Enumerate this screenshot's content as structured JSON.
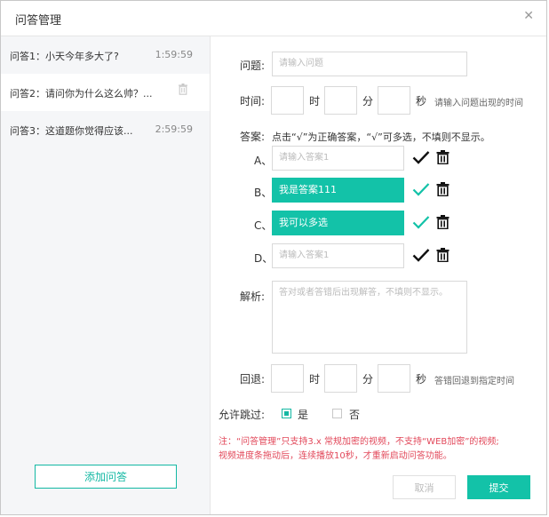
{
  "dialog": {
    "title": "问答管理"
  },
  "sidebar": {
    "items": [
      {
        "text": "问答1：小天今年多大了?",
        "time": "1:59:59"
      },
      {
        "text": "问答2：请问你为什么这么帅？...",
        "time": ""
      },
      {
        "text": "问答3：这道题你觉得应该...",
        "time": "2:59:59"
      }
    ],
    "add_label": "添加问答"
  },
  "form": {
    "question": {
      "label": "问题:",
      "placeholder": "请输入问题"
    },
    "time": {
      "label": "时间:",
      "hour": "时",
      "minute": "分",
      "second": "秒",
      "hint": "请输入问题出现的时间"
    },
    "answer_label": "答案:",
    "answer_instruction": "点击“√”为正确答案，“√”可多选，不填则不显示。",
    "answers": [
      {
        "letter": "A、",
        "value": "",
        "placeholder": "请输入答案1"
      },
      {
        "letter": "B、",
        "value": "我是答案111",
        "placeholder": ""
      },
      {
        "letter": "C、",
        "value": "我可以多选",
        "placeholder": ""
      },
      {
        "letter": "D、",
        "value": "",
        "placeholder": "请输入答案1"
      }
    ],
    "analysis": {
      "label": "解析:",
      "placeholder": "答对或者答错后出现解答，不填则不显示。"
    },
    "rewind": {
      "label": "回退:",
      "hour": "时",
      "minute": "分",
      "second": "秒",
      "hint": "答错回退到指定时间"
    },
    "allow_skip": {
      "label": "允许跳过:",
      "yes": "是",
      "no": "否",
      "selected": "是"
    }
  },
  "notes": {
    "line1": "注：“问答管理”只支持3.x 常规加密的视频，不支持“WEB加密”的视频;",
    "line2": "视频进度条拖动后，连续播放10秒，才重新启动问答功能。"
  },
  "footer": {
    "cancel": "取消",
    "submit": "提交"
  },
  "colors": {
    "accent": "#13c2a8",
    "warning": "#e2485a"
  }
}
